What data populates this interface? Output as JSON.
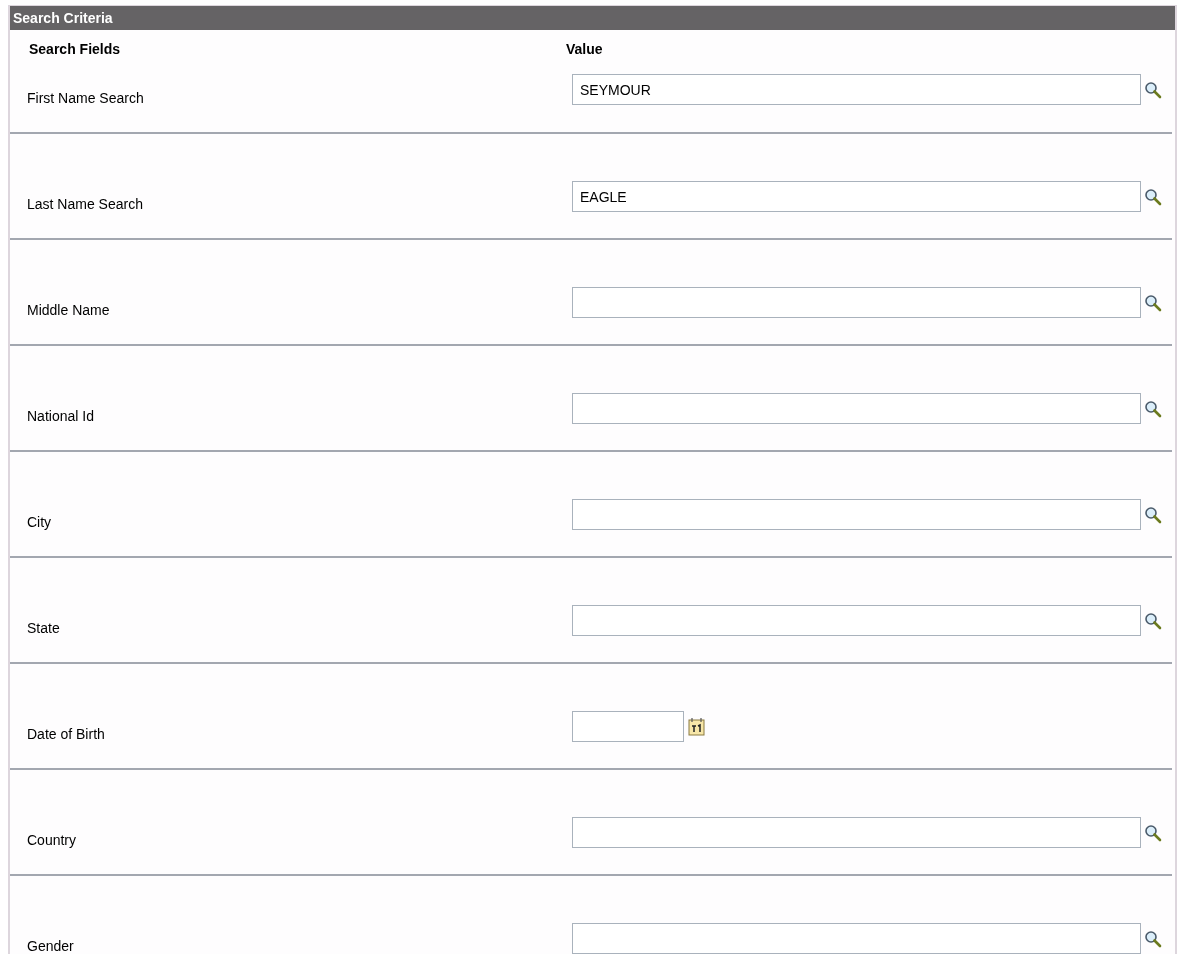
{
  "panel": {
    "title": "Search Criteria"
  },
  "columns": [
    "Search Fields",
    "Value"
  ],
  "fields": [
    {
      "label": "First Name Search",
      "kind": "lookup",
      "value": "SEYMOUR"
    },
    {
      "label": "Last Name Search",
      "kind": "lookup",
      "value": "EAGLE"
    },
    {
      "label": "Middle Name",
      "kind": "lookup"
    },
    {
      "label": "National Id",
      "kind": "lookup"
    },
    {
      "label": "City",
      "kind": "lookup"
    },
    {
      "label": "State",
      "kind": "lookup"
    },
    {
      "label": "Date of Birth",
      "kind": "date"
    },
    {
      "label": "Country",
      "kind": "lookup"
    },
    {
      "label": "Gender",
      "kind": "lookup"
    }
  ]
}
